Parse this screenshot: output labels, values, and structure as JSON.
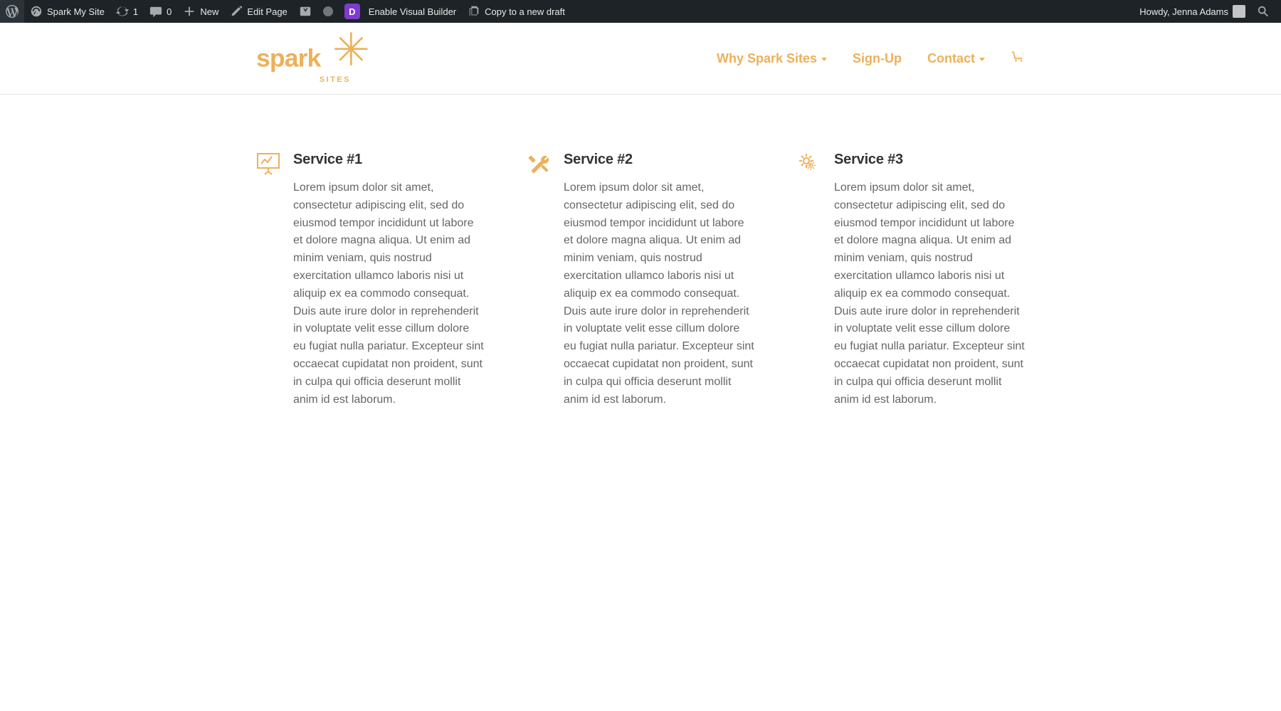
{
  "adminbar": {
    "site_name": "Spark My Site",
    "updates_count": "1",
    "comments_count": "0",
    "new_label": "New",
    "edit_label": "Edit Page",
    "visual_builder": "Enable Visual Builder",
    "copy_draft": "Copy to a new draft",
    "howdy": "Howdy, Jenna Adams"
  },
  "nav": {
    "items": [
      {
        "label": "Why Spark Sites",
        "has_submenu": true
      },
      {
        "label": "Sign-Up",
        "has_submenu": false
      },
      {
        "label": "Contact",
        "has_submenu": true
      }
    ]
  },
  "logo": {
    "main": "spark",
    "sub": "SITES"
  },
  "services": [
    {
      "title": "Service #1",
      "body": "Lorem ipsum dolor sit amet, consectetur adipiscing elit, sed do eiusmod tempor incididunt ut labore et dolore magna aliqua. Ut enim ad minim veniam, quis nostrud exercitation ullamco laboris nisi ut aliquip ex ea commodo consequat. Duis aute irure dolor in reprehenderit in voluptate velit esse cillum dolore eu fugiat nulla pariatur. Excepteur sint occaecat cupidatat non proident, sunt in culpa qui officia deserunt mollit anim id est laborum."
    },
    {
      "title": "Service #2",
      "body": "Lorem ipsum dolor sit amet, consectetur adipiscing elit, sed do eiusmod tempor incididunt ut labore et dolore magna aliqua. Ut enim ad minim veniam, quis nostrud exercitation ullamco laboris nisi ut aliquip ex ea commodo consequat. Duis aute irure dolor in reprehenderit in voluptate velit esse cillum dolore eu fugiat nulla pariatur. Excepteur sint occaecat cupidatat non proident, sunt in culpa qui officia deserunt mollit anim id est laborum."
    },
    {
      "title": "Service #3",
      "body": "Lorem ipsum dolor sit amet, consectetur adipiscing elit, sed do eiusmod tempor incididunt ut labore et dolore magna aliqua. Ut enim ad minim veniam, quis nostrud exercitation ullamco laboris nisi ut aliquip ex ea commodo consequat. Duis aute irure dolor in reprehenderit in voluptate velit esse cillum dolore eu fugiat nulla pariatur. Excepteur sint occaecat cupidatat non proident, sunt in culpa qui officia deserunt mollit anim id est laborum."
    }
  ],
  "colors": {
    "accent": "#edb059"
  }
}
